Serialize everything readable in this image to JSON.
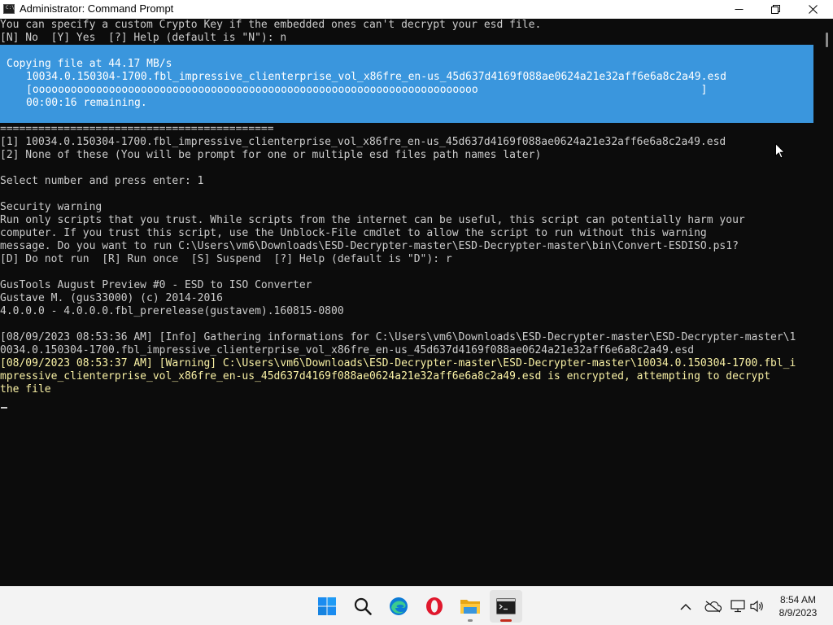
{
  "window": {
    "title": "Administrator: Command Prompt",
    "icon": "console-icon",
    "icon_text": "C:\\"
  },
  "console": {
    "lines_top": [
      "You can specify a custom Crypto Key if the embedded ones can't decrypt your esd file.",
      "[N] No  [Y] Yes  [?] Help (default is \"N\"): n"
    ],
    "progress": {
      "heading": "Copying file at 44.17 MB/s",
      "filename": "10034.0.150304-1700.fbl_impressive_clienterprise_vol_x86fre_en-us_45d637d4169f088ae0624a21e32aff6e6a8c2a49.esd",
      "bar": "[oooooooooooooooooooooooooooooooooooooooooooooooooooooooooooooooooooooo                                   ]",
      "remaining": "00:00:16 remaining."
    },
    "lines_main": [
      "===========================================",
      "[1] 10034.0.150304-1700.fbl_impressive_clienterprise_vol_x86fre_en-us_45d637d4169f088ae0624a21e32aff6e6a8c2a49.esd",
      "[2] None of these (You will be prompt for one or multiple esd files path names later)",
      "",
      "Select number and press enter: 1",
      "",
      "Security warning",
      "Run only scripts that you trust. While scripts from the internet can be useful, this script can potentially harm your",
      "computer. If you trust this script, use the Unblock-File cmdlet to allow the script to run without this warning",
      "message. Do you want to run C:\\Users\\vm6\\Downloads\\ESD-Decrypter-master\\ESD-Decrypter-master\\bin\\Convert-ESDISO.ps1?",
      "[D] Do not run  [R] Run once  [S] Suspend  [?] Help (default is \"D\"): r",
      "",
      "GusTools August Preview #0 - ESD to ISO Converter",
      "Gustave M. (gus33000) (c) 2014-2016",
      "4.0.0.0 - 4.0.0.0.fbl_prerelease(gustavem).160815-0800",
      "",
      "[08/09/2023 08:53:36 AM] [Info] Gathering informations for C:\\Users\\vm6\\Downloads\\ESD-Decrypter-master\\ESD-Decrypter-master\\1",
      "0034.0.150304-1700.fbl_impressive_clienterprise_vol_x86fre_en-us_45d637d4169f088ae0624a21e32aff6e6a8c2a49.esd"
    ],
    "lines_warning": [
      "[08/09/2023 08:53:37 AM] [Warning] C:\\Users\\vm6\\Downloads\\ESD-Decrypter-master\\ESD-Decrypter-master\\10034.0.150304-1700.fbl_i",
      "mpressive_clienterprise_vol_x86fre_en-us_45d637d4169f088ae0624a21e32aff6e6a8c2a49.esd is encrypted, attempting to decrypt",
      "the file"
    ]
  },
  "colors": {
    "console_background": "#0c0c0c",
    "console_text": "#cccccc",
    "progress_background": "#3a96dd",
    "warning_text": "#f9f1a5"
  },
  "taskbar": {
    "apps": [
      {
        "name": "start",
        "icon": "windows-logo-icon"
      },
      {
        "name": "search",
        "icon": "search-icon"
      },
      {
        "name": "edge",
        "icon": "edge-icon"
      },
      {
        "name": "opera",
        "icon": "opera-icon"
      },
      {
        "name": "file-explorer",
        "icon": "folder-icon"
      },
      {
        "name": "command-prompt",
        "icon": "console-icon",
        "active": true
      }
    ],
    "tray": {
      "icons": [
        "chevron-up-icon",
        "onedrive-icon",
        "network-icon",
        "volume-icon"
      ],
      "time": "8:54 AM",
      "date": "8/9/2023"
    }
  }
}
